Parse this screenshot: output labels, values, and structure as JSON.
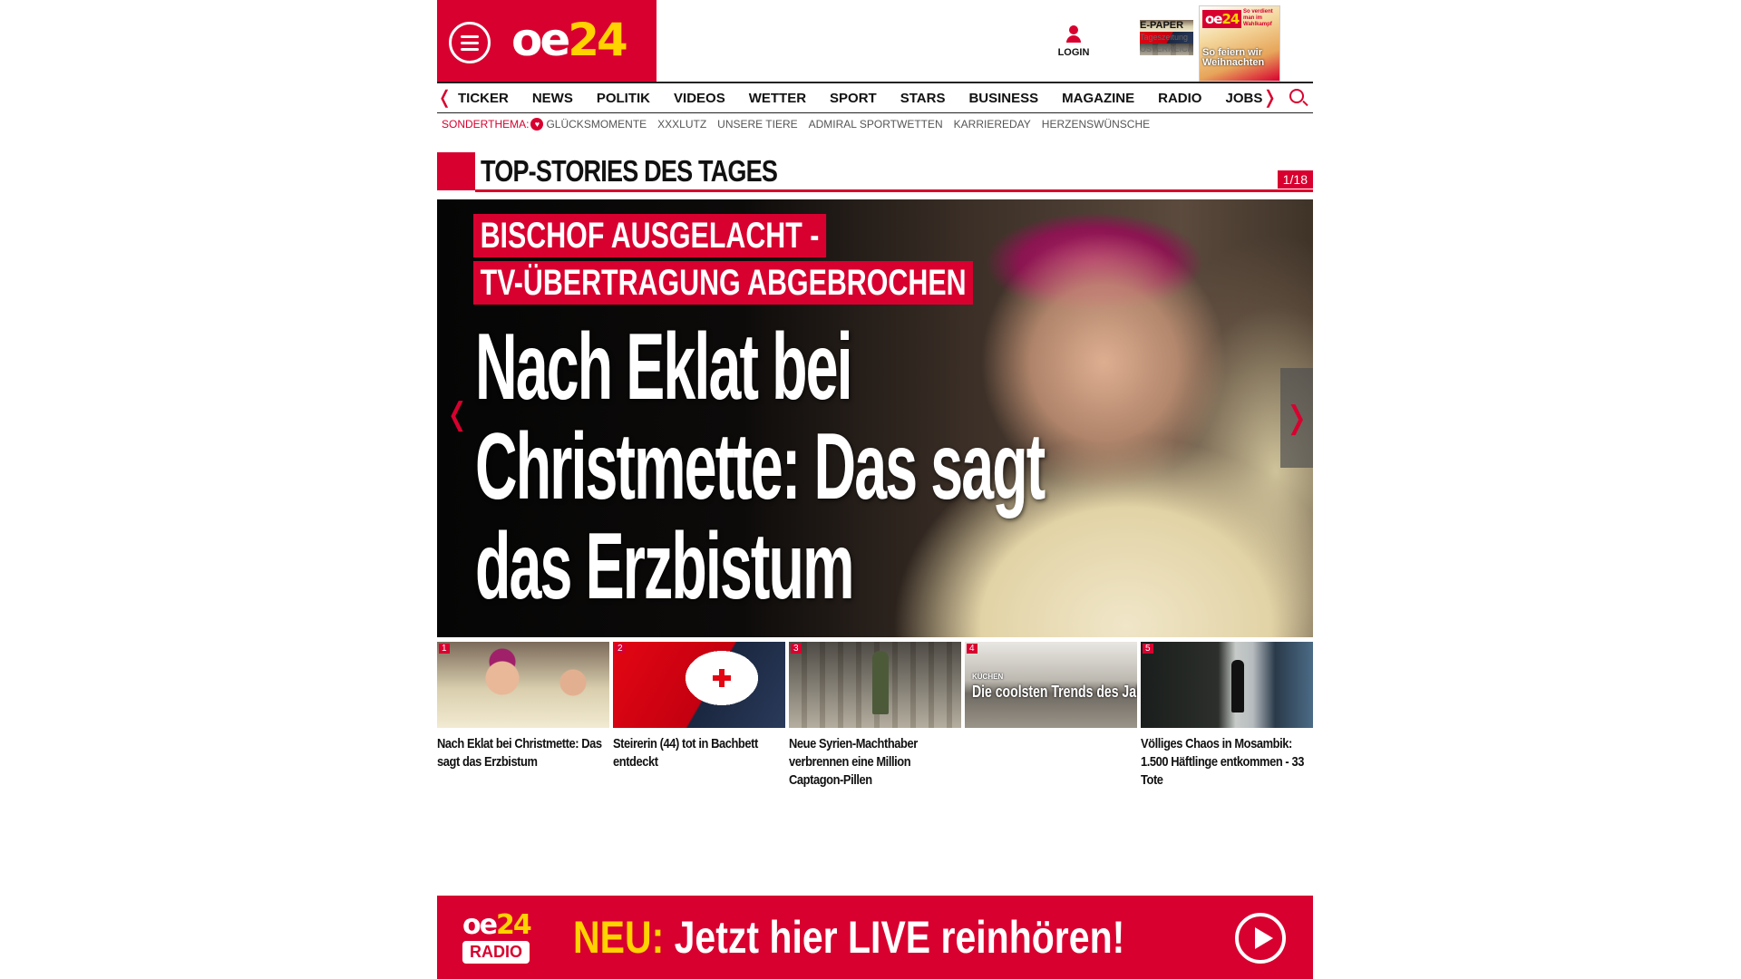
{
  "header": {
    "logo_main": "oe",
    "logo_accent": "24",
    "login_label": "LOGIN",
    "epaper": {
      "title": "E-PAPER",
      "line1": "Tageszeitung",
      "line2": "ÖSTERREICH"
    },
    "cover": {
      "logo_main": "oe",
      "logo_accent": "24",
      "headline": "So feiern wir Weihnachten",
      "top_text": "So verdient man im Wahlkampf"
    }
  },
  "nav": {
    "items": [
      "TICKER",
      "NEWS",
      "POLITIK",
      "VIDEOS",
      "WETTER",
      "SPORT",
      "STARS",
      "BUSINESS",
      "MAGAZINE",
      "RADIO",
      "JOBS"
    ],
    "prev_glyph": "❬",
    "next_glyph": "❭"
  },
  "subnav": {
    "lead": "SONDERTHEMA:",
    "heart": "♥",
    "items": [
      "GLÜCKSMOMENTE",
      "XXXLUTZ",
      "UNSERE TIERE",
      "ADMIRAL SPORTWETTEN",
      "KARRIEREDAY",
      "HERZENSWÜNSCHE"
    ]
  },
  "top_stories": {
    "title": "TOP-STORIES DES TAGES",
    "counter": "1/18"
  },
  "hero": {
    "kicker_line1": "BISCHOF AUSGELACHT -",
    "kicker_line2": "TV-ÜBERTRAGUNG ABGEBROCHEN",
    "headline": "Nach Eklat bei Christmette: Das sagt das Erzbistum",
    "prev_glyph": "❬",
    "next_glyph": "❭"
  },
  "cards": [
    {
      "num": "1",
      "caption": "Nach Eklat bei Christmette: Das sagt das Erzbistum"
    },
    {
      "num": "2",
      "caption": "Steirerin (44) tot in Bachbett entdeckt"
    },
    {
      "num": "3",
      "caption": "Neue Syrien-Machthaber verbrennen eine Million Captagon-Pillen"
    },
    {
      "num": "4",
      "caption": "",
      "overlay_small": "KÜCHEN",
      "overlay_big": "Die coolsten Trends des Jahres"
    },
    {
      "num": "5",
      "caption": "Völliges Chaos in Mosambik: 1.500 Häftlinge entkommen - 33 Tote"
    }
  ],
  "radio_banner": {
    "logo_main": "oe",
    "logo_accent": "24",
    "logo_label": "RADIO",
    "neu": "NEU:",
    "text": "Jetzt hier LIVE reinhören!"
  },
  "colors": {
    "brand_red": "#d8002f",
    "accent_yellow": "#ffd200"
  }
}
